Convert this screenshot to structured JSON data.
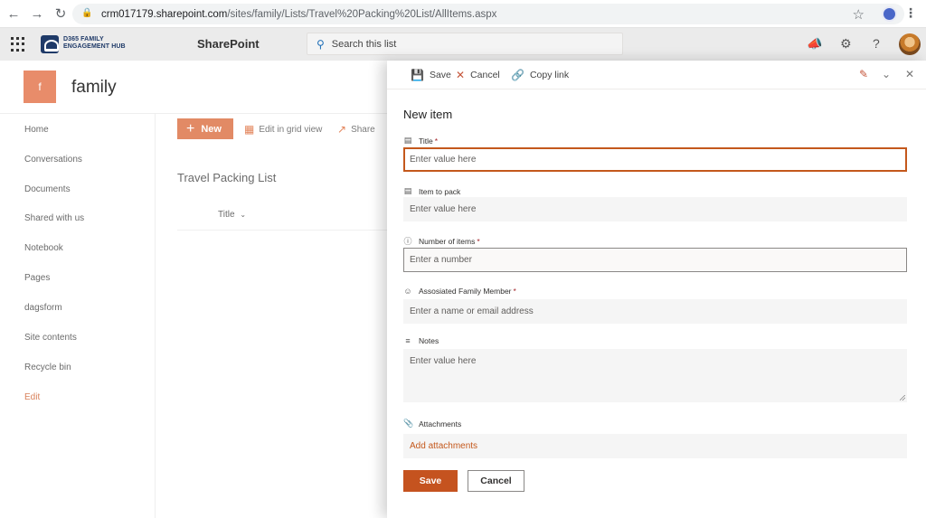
{
  "browser": {
    "url_host": "crm017179.sharepoint.com",
    "url_path": "/sites/family/Lists/Travel%20Packing%20List/AllItems.aspx"
  },
  "suite": {
    "hub_name_line1": "D365 FAMILY",
    "hub_name_line2": "ENGAGEMENT HUB",
    "app_title": "SharePoint",
    "search_placeholder": "Search this list",
    "icons": [
      "megaphone-icon",
      "gear-icon",
      "help-icon"
    ]
  },
  "site": {
    "logo_letter": "f",
    "name": "family"
  },
  "leftnav": {
    "items": [
      "Home",
      "Conversations",
      "Documents",
      "Shared with us",
      "Notebook",
      "Pages",
      "dagsform",
      "Site contents",
      "Recycle bin"
    ],
    "edit_label": "Edit"
  },
  "list": {
    "new_label": "New",
    "grid_label": "Edit in grid view",
    "share_label": "Share",
    "title": "Travel Packing List",
    "column_title": "Title"
  },
  "panel": {
    "save_label": "Save",
    "cancel_label": "Cancel",
    "copy_link_label": "Copy link",
    "form_title": "New item",
    "fields": {
      "title_label": "Title",
      "title_placeholder": "Enter value here",
      "item_label": "Item to pack",
      "item_placeholder": "Enter value here",
      "number_label": "Number of items",
      "number_placeholder": "Enter a number",
      "member_label": "Assosiated Family Member",
      "member_placeholder": "Enter a name or email address",
      "notes_label": "Notes",
      "notes_placeholder": "Enter value here",
      "attachments_label": "Attachments",
      "attachments_link": "Add attachments"
    },
    "required_marker": "*",
    "footer_save": "Save",
    "footer_cancel": "Cancel"
  },
  "colors": {
    "accent": "#c5531f",
    "site_logo": "#e88c6a",
    "new_button": "#e28a65"
  }
}
